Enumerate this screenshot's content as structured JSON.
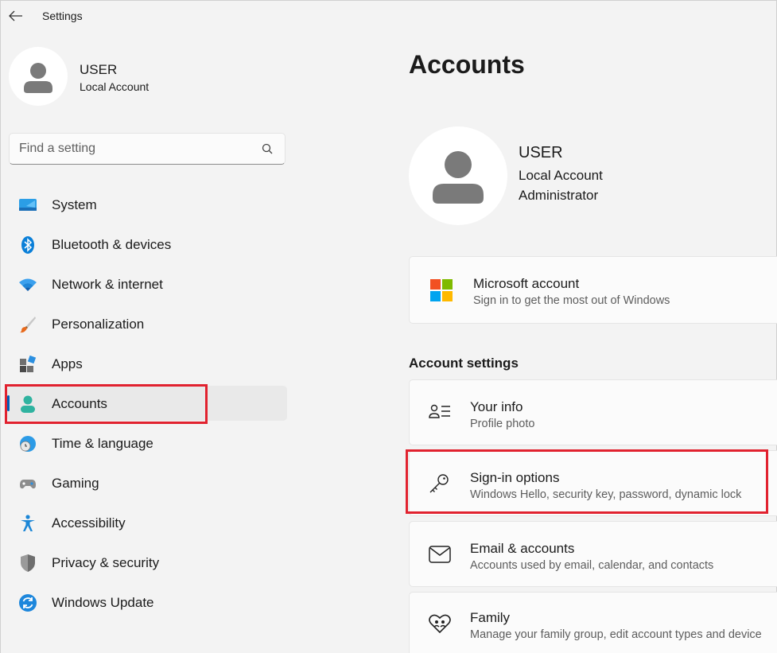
{
  "window": {
    "title": "Settings"
  },
  "user": {
    "name": "USER",
    "type": "Local Account"
  },
  "search": {
    "placeholder": "Find a setting"
  },
  "nav": {
    "items": [
      {
        "label": "System",
        "icon": "system-icon"
      },
      {
        "label": "Bluetooth & devices",
        "icon": "bluetooth-icon"
      },
      {
        "label": "Network & internet",
        "icon": "wifi-icon"
      },
      {
        "label": "Personalization",
        "icon": "brush-icon"
      },
      {
        "label": "Apps",
        "icon": "apps-icon"
      },
      {
        "label": "Accounts",
        "icon": "person-icon",
        "selected": true
      },
      {
        "label": "Time & language",
        "icon": "clock-globe-icon"
      },
      {
        "label": "Gaming",
        "icon": "gamepad-icon"
      },
      {
        "label": "Accessibility",
        "icon": "accessibility-icon"
      },
      {
        "label": "Privacy & security",
        "icon": "shield-icon"
      },
      {
        "label": "Windows Update",
        "icon": "update-icon"
      }
    ]
  },
  "main": {
    "title": "Accounts",
    "profile": {
      "name": "USER",
      "line1": "Local Account",
      "line2": "Administrator"
    },
    "microsoft_account": {
      "title": "Microsoft account",
      "subtitle": "Sign in to get the most out of Windows"
    },
    "section_title": "Account settings",
    "settings": [
      {
        "title": "Your info",
        "subtitle": "Profile photo",
        "icon": "person-lines-icon"
      },
      {
        "title": "Sign-in options",
        "subtitle": "Windows Hello, security key, password, dynamic lock",
        "icon": "key-icon"
      },
      {
        "title": "Email & accounts",
        "subtitle": "Accounts used by email, calendar, and contacts",
        "icon": "mail-icon"
      },
      {
        "title": "Family",
        "subtitle": "Manage your family group, edit account types and device",
        "icon": "family-heart-icon"
      }
    ]
  },
  "colors": {
    "accent": "#005fb8",
    "highlight": "#e1222f",
    "background": "#f3f3f3"
  }
}
